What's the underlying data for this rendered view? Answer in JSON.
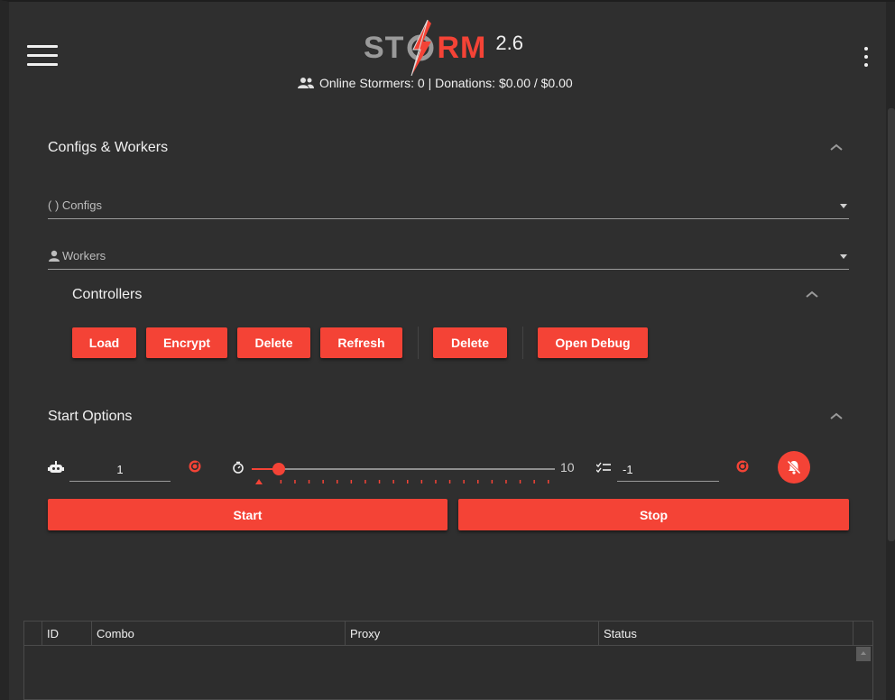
{
  "header": {
    "logo_left": "ST",
    "logo_right": "RM",
    "version": "2.6",
    "online_text": "Online Stormers: 0 | Donations: $0.00 / $0.00"
  },
  "configs_workers": {
    "title": "Configs & Workers",
    "configs_label": "( ) Configs",
    "workers_label": "Workers"
  },
  "controllers": {
    "title": "Controllers",
    "buttons": [
      "Load",
      "Encrypt",
      "Delete",
      "Refresh",
      "Delete",
      "Open Debug"
    ]
  },
  "start_options": {
    "title": "Start Options",
    "bots_value": "1",
    "slider_max_label": "10",
    "slider_fraction": 0.05,
    "retries_value": "-1",
    "start_label": "Start",
    "stop_label": "Stop"
  },
  "grid": {
    "columns": [
      "ID",
      "Combo",
      "Proxy",
      "Status"
    ]
  },
  "colors": {
    "accent": "#f44336",
    "background": "#2f2f2f",
    "text": "#f0f0f0"
  },
  "icons": [
    "menu-icon",
    "storm-bolt-icon",
    "more-vert-icon",
    "people-icon",
    "chevron-up-icon",
    "worker-icon",
    "robot-icon",
    "refresh-icon",
    "timer-icon",
    "list-icon",
    "bell-off-icon"
  ]
}
